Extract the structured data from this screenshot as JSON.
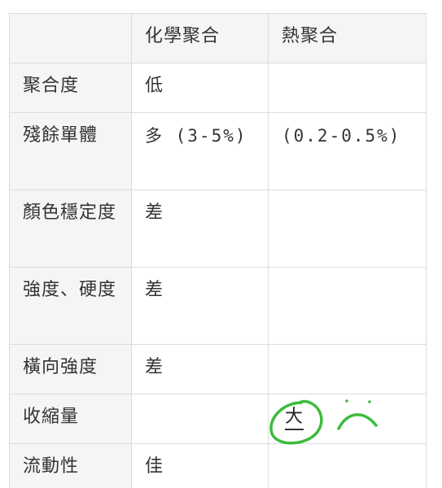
{
  "table": {
    "headers": [
      "",
      "化學聚合",
      "熱聚合"
    ],
    "rows": [
      {
        "label": "聚合度",
        "chemical": "低",
        "thermal": ""
      },
      {
        "label": "殘餘單體",
        "chemical": "多 (3-5%)",
        "thermal": "(0.2-0.5%)"
      },
      {
        "label": "顏色穩定度",
        "chemical": "差",
        "thermal": ""
      },
      {
        "label": "強度、硬度",
        "chemical": "差",
        "thermal": ""
      },
      {
        "label": "橫向強度",
        "chemical": "差",
        "thermal": ""
      },
      {
        "label": "收縮量",
        "chemical": "",
        "thermal": "大"
      },
      {
        "label": "流動性",
        "chemical": "佳",
        "thermal": ""
      }
    ]
  },
  "annotation": {
    "color": "#3dbb3d",
    "mark": "circled-text-with-frown-doodle"
  }
}
